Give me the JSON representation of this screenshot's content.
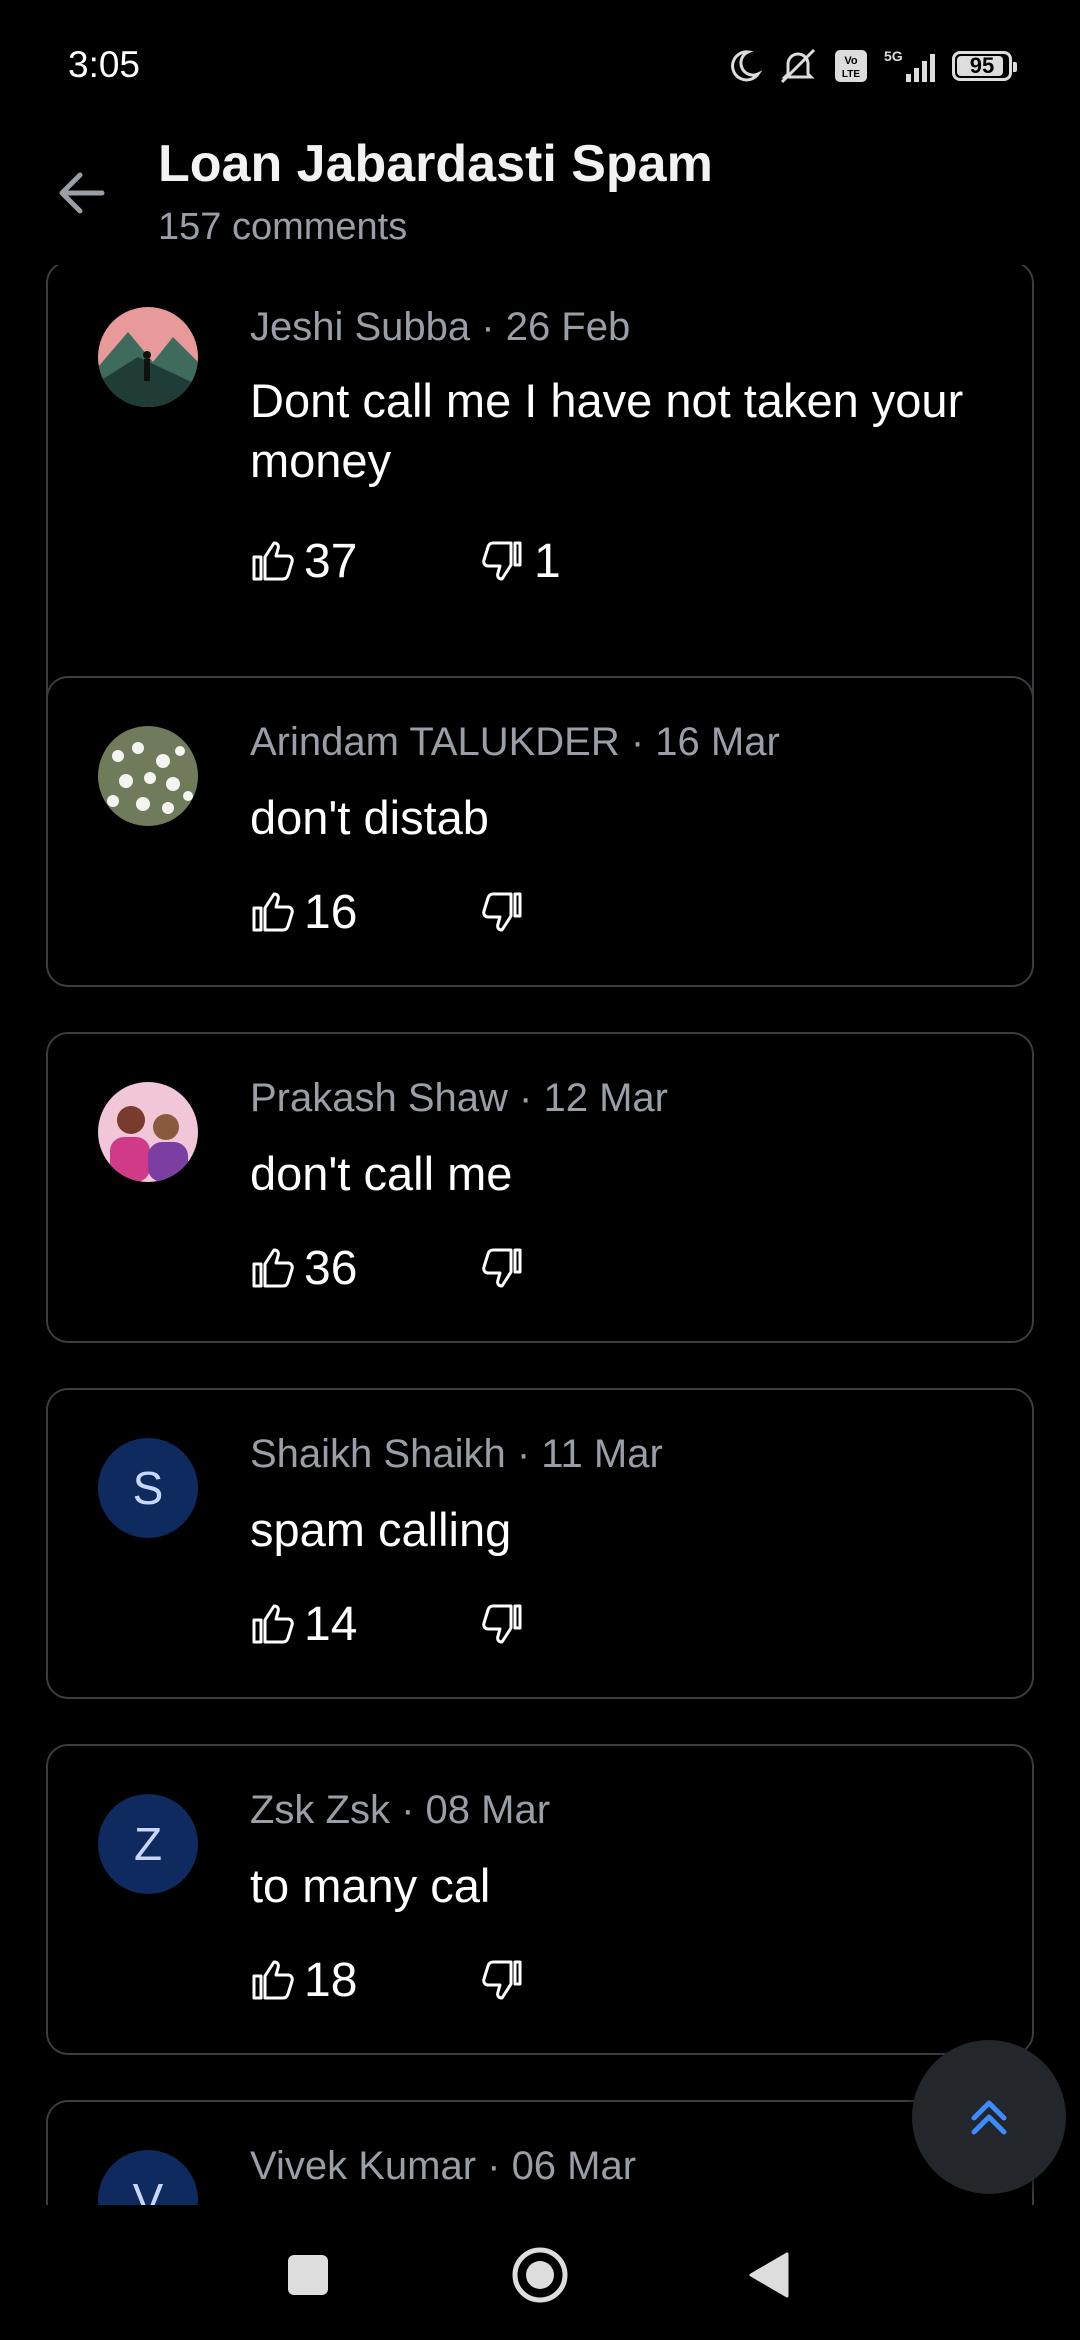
{
  "status_bar": {
    "time": "3:05",
    "battery": "95",
    "network": "5G",
    "icons": [
      "moon-icon",
      "mute-bell-icon",
      "volte-icon",
      "signal-icon",
      "battery-icon"
    ]
  },
  "header": {
    "title": "Loan Jabardasti Spam",
    "subtitle": "157 comments",
    "back_icon": "arrow-left-icon"
  },
  "comments": [
    {
      "author_meta": "Jeshi Subba · 26 Feb",
      "text": "Dont call me I have not taken your money",
      "likes": "37",
      "dislikes": "1",
      "avatar": "photo-mountain"
    },
    {
      "author_meta": "Arindam TALUKDER · 16 Mar",
      "text": "don't distab",
      "likes": "16",
      "dislikes": "",
      "avatar": "photo-flowers"
    },
    {
      "author_meta": "Prakash Shaw · 12 Mar",
      "text": "don't call me",
      "likes": "36",
      "dislikes": "",
      "avatar": "photo-people"
    },
    {
      "author_meta": "Shaikh Shaikh · 11 Mar",
      "text": "spam calling",
      "likes": "14",
      "dislikes": "",
      "avatar_letter": "S"
    },
    {
      "author_meta": "Zsk Zsk · 08 Mar",
      "text": "to many cal",
      "likes": "18",
      "dislikes": "",
      "avatar_letter": "Z"
    },
    {
      "author_meta": "Vivek Kumar · 06 Mar",
      "text": "",
      "likes": "",
      "dislikes": "",
      "avatar_letter": "V"
    }
  ],
  "fab": {
    "icon": "double-chevron-up-icon"
  },
  "navbar": {
    "icons": [
      "recents-square-icon",
      "home-circle-icon",
      "back-triangle-icon"
    ]
  },
  "colors": {
    "background": "#000000",
    "card_border": "#3a3d42",
    "meta": "#9a9ea6",
    "avatar_bg": "#0f2a5e",
    "fab_accent": "#3d8bff"
  }
}
